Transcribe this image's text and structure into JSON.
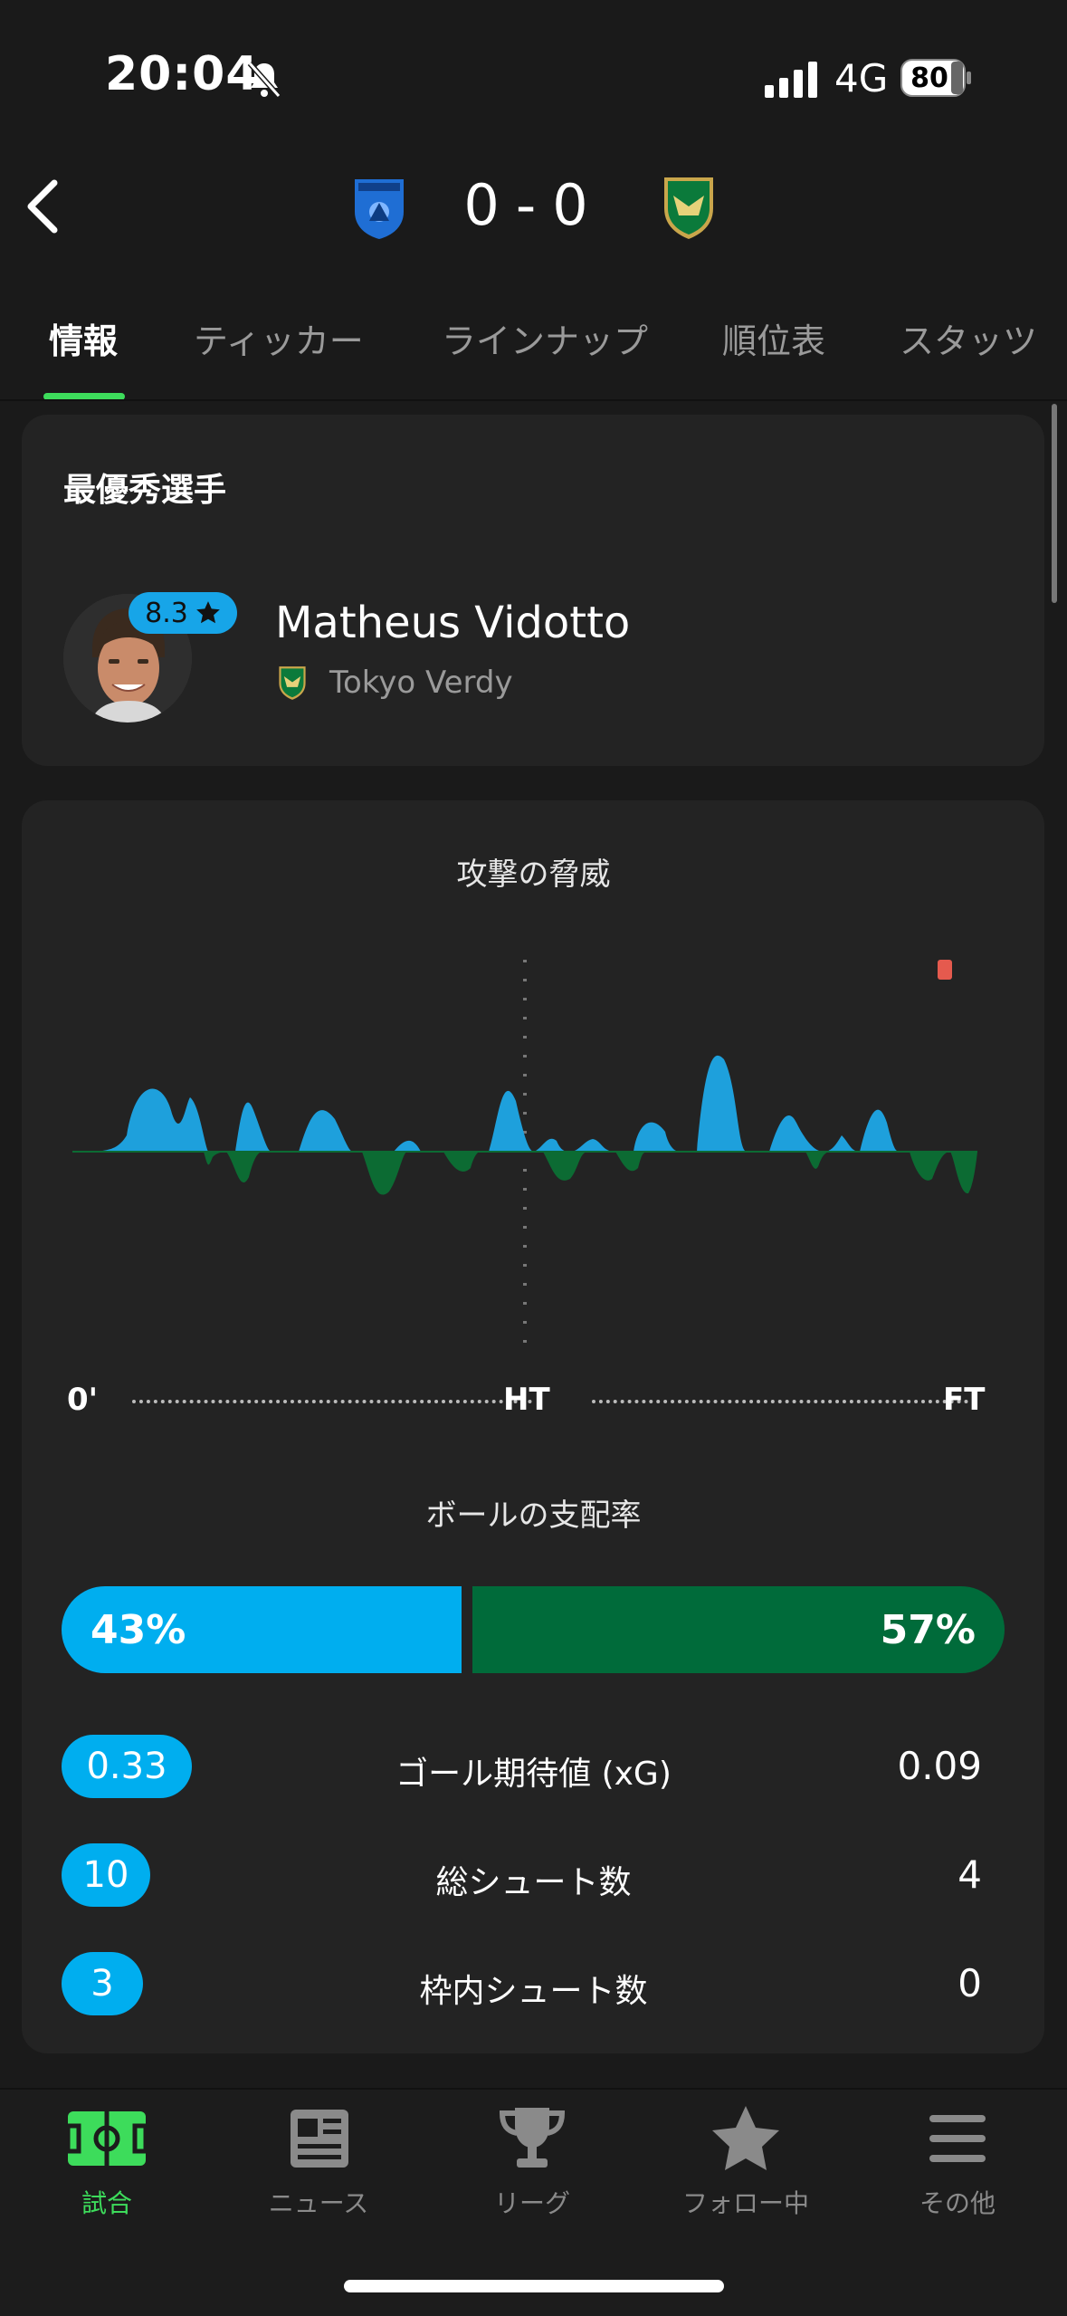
{
  "status_bar": {
    "time": "20:04",
    "network": "4G",
    "battery": "80"
  },
  "match": {
    "home_score": "0",
    "separator": "-",
    "away_score": "0",
    "home_color": "#1f6ed4",
    "away_color": "#0b7a3b"
  },
  "tabs": [
    {
      "label": "情報",
      "active": true
    },
    {
      "label": "ティッカー"
    },
    {
      "label": "ラインナップ"
    },
    {
      "label": "順位表"
    },
    {
      "label": "スタッツ"
    }
  ],
  "best_player": {
    "title": "最優秀選手",
    "rating": "8.3",
    "name": "Matheus Vidotto",
    "team": "Tokyo Verdy"
  },
  "attack_threat": {
    "title": "攻撃の脅威",
    "timeline": {
      "start": "0'",
      "half": "HT",
      "end": "FT"
    },
    "home_color": "#1ea0dc",
    "away_color": "#0c6b33"
  },
  "possession": {
    "title": "ボールの支配率",
    "home": "43%",
    "away": "57%",
    "home_value": 43,
    "away_value": 57
  },
  "stats": [
    {
      "label": "ゴール期待値 (xG)",
      "home": "0.33",
      "away": "0.09"
    },
    {
      "label": "総シュート数",
      "home": "10",
      "away": "4"
    },
    {
      "label": "枠内シュート数",
      "home": "3",
      "away": "0"
    }
  ],
  "bottom_nav": [
    {
      "label": "試合",
      "icon": "pitch-icon",
      "active": true
    },
    {
      "label": "ニュース",
      "icon": "news-icon"
    },
    {
      "label": "リーグ",
      "icon": "trophy-icon"
    },
    {
      "label": "フォロー中",
      "icon": "star-icon"
    },
    {
      "label": "その他",
      "icon": "menu-icon"
    }
  ]
}
